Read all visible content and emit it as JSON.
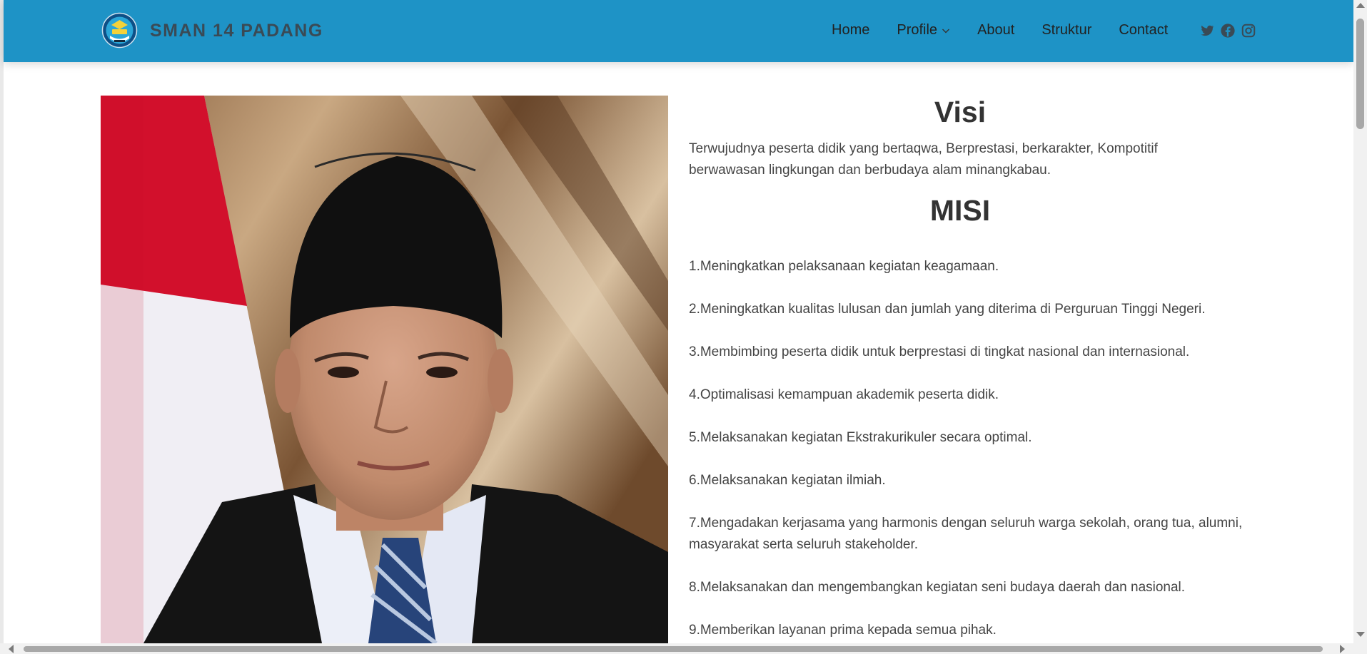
{
  "header": {
    "brand": "SMAN 14 PADANG",
    "logo_icon": "school-crest-icon",
    "nav": [
      {
        "label": "Home",
        "has_dropdown": false
      },
      {
        "label": "Profile",
        "has_dropdown": true
      },
      {
        "label": "About",
        "has_dropdown": false
      },
      {
        "label": "Struktur",
        "has_dropdown": false
      },
      {
        "label": "Contact",
        "has_dropdown": false
      }
    ],
    "social_icons": [
      "twitter-icon",
      "facebook-icon",
      "instagram-icon"
    ]
  },
  "visi": {
    "heading": "Visi",
    "text": "Terwujudnya peserta didik yang bertaqwa, Berprestasi, berkarakter, Kompotitif berwawasan lingkungan dan berbudaya alam minangkabau."
  },
  "misi": {
    "heading": "MISI",
    "items": [
      "1.Meningkatkan pelaksanaan kegiatan keagamaan.",
      "2.Meningkatkan kualitas lulusan dan jumlah yang diterima di Perguruan Tinggi Negeri.",
      "3.Membimbing peserta didik untuk berprestasi di tingkat nasional dan internasional.",
      "4.Optimalisasi kemampuan akademik peserta didik.",
      "5.Melaksanakan kegiatan Ekstrakurikuler secara optimal.",
      "6.Melaksanakan kegiatan ilmiah.",
      "7.Mengadakan kerjasama yang harmonis dengan seluruh warga sekolah, orang tua, alumni, masyarakat serta seluruh stakeholder.",
      "8.Melaksanakan dan mengembangkan kegiatan seni budaya daerah dan nasional.",
      "9.Memberikan layanan prima kepada semua pihak."
    ]
  },
  "colors": {
    "navbar": "#1e93c6",
    "brand_text": "#3a4a55",
    "body_text": "#444444",
    "heading_text": "#333333"
  }
}
